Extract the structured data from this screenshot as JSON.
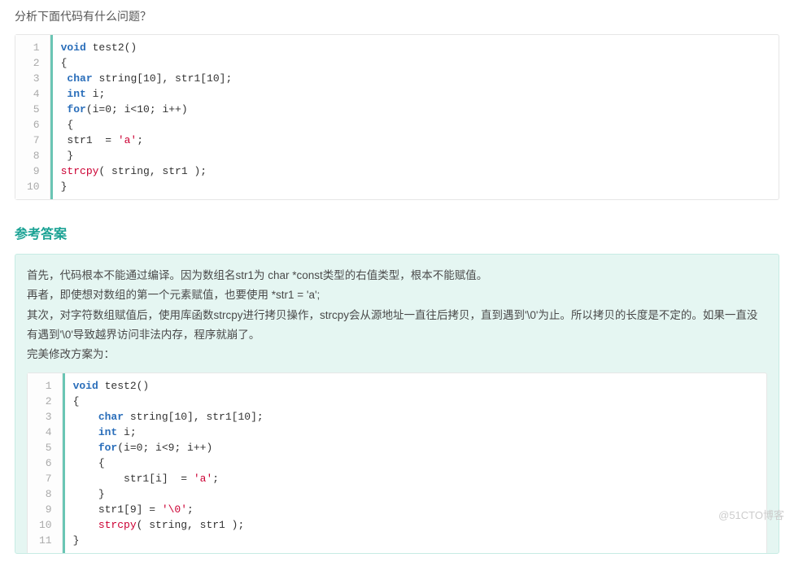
{
  "question": "分析下面代码有什么问题？",
  "code1": {
    "lines": [
      [
        {
          "t": "void ",
          "c": "kw"
        },
        {
          "t": "test2()"
        }
      ],
      [
        {
          "t": "{"
        }
      ],
      [
        {
          "t": " "
        },
        {
          "t": "char ",
          "c": "kw"
        },
        {
          "t": "string[10], str1[10];"
        }
      ],
      [
        {
          "t": " "
        },
        {
          "t": "int ",
          "c": "kw"
        },
        {
          "t": "i;"
        }
      ],
      [
        {
          "t": " "
        },
        {
          "t": "for",
          "c": "kw"
        },
        {
          "t": "(i=0; i<10; i++)"
        }
      ],
      [
        {
          "t": " {"
        }
      ],
      [
        {
          "t": " str1  = "
        },
        {
          "t": "'a'",
          "c": "ch"
        },
        {
          "t": ";"
        }
      ],
      [
        {
          "t": " }"
        }
      ],
      [
        {
          "t": "strcpy",
          "c": "call"
        },
        {
          "t": "( string, str1 );"
        }
      ],
      [
        {
          "t": "}"
        }
      ]
    ]
  },
  "answer_heading": "参考答案",
  "answer_paragraphs": [
    "首先，代码根本不能通过编译。因为数组名str1为 char *const类型的右值类型，根本不能赋值。",
    "再者，即使想对数组的第一个元素赋值，也要使用 *str1 = 'a';",
    "其次，对字符数组赋值后，使用库函数strcpy进行拷贝操作，strcpy会从源地址一直往后拷贝，直到遇到'\\0'为止。所以拷贝的长度是不定的。如果一直没有遇到'\\0'导致越界访问非法内存，程序就崩了。",
    "完美修改方案为："
  ],
  "code2": {
    "lines": [
      [
        {
          "t": "void ",
          "c": "kw"
        },
        {
          "t": "test2()"
        }
      ],
      [
        {
          "t": "{"
        }
      ],
      [
        {
          "t": "    "
        },
        {
          "t": "char ",
          "c": "kw"
        },
        {
          "t": "string[10], str1[10];"
        }
      ],
      [
        {
          "t": "    "
        },
        {
          "t": "int ",
          "c": "kw"
        },
        {
          "t": "i;"
        }
      ],
      [
        {
          "t": "    "
        },
        {
          "t": "for",
          "c": "kw"
        },
        {
          "t": "(i=0; i<9; i++)"
        }
      ],
      [
        {
          "t": "    {"
        }
      ],
      [
        {
          "t": "        str1[i]  = "
        },
        {
          "t": "'a'",
          "c": "ch"
        },
        {
          "t": ";"
        }
      ],
      [
        {
          "t": "    }"
        }
      ],
      [
        {
          "t": "    str1[9] = "
        },
        {
          "t": "'\\0'",
          "c": "ch"
        },
        {
          "t": ";"
        }
      ],
      [
        {
          "t": "    "
        },
        {
          "t": "strcpy",
          "c": "call"
        },
        {
          "t": "( string, str1 );"
        }
      ],
      [
        {
          "t": "}"
        }
      ]
    ]
  },
  "watermark": "@51CTO博客"
}
